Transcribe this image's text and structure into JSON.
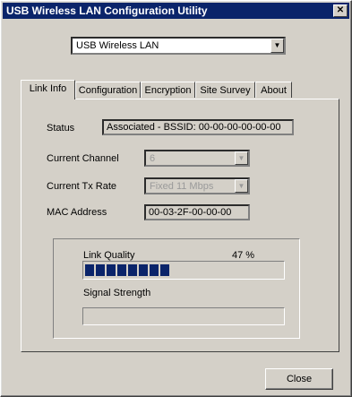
{
  "window": {
    "title": "USB Wireless LAN Configuration Utility",
    "close_glyph": "✕"
  },
  "adapter_select": {
    "value": "USB Wireless LAN",
    "arrow": "▼"
  },
  "tabs": [
    {
      "label": "Link Info",
      "active": true
    },
    {
      "label": "Configuration",
      "active": false
    },
    {
      "label": "Encryption",
      "active": false
    },
    {
      "label": "Site Survey",
      "active": false
    },
    {
      "label": "About",
      "active": false
    }
  ],
  "link_info": {
    "status_label": "Status",
    "status_value": "Associated - BSSID: 00-00-00-00-00-00",
    "channel_label": "Current Channel",
    "channel_value": "6",
    "tx_rate_label": "Current Tx Rate",
    "tx_rate_value": "Fixed 11 Mbps",
    "mac_label": "MAC Address",
    "mac_value": "00-03-2F-00-00-00",
    "link_quality_label": "Link Quality",
    "link_quality_value": "47 %",
    "link_quality_percent": 47,
    "signal_strength_label": "Signal Strength",
    "signal_strength_percent": 0
  },
  "close_button": {
    "label": "Close"
  },
  "colors": {
    "titlebar": "#0a246a",
    "face": "#d4d0c8",
    "progress": "#0a246a"
  }
}
